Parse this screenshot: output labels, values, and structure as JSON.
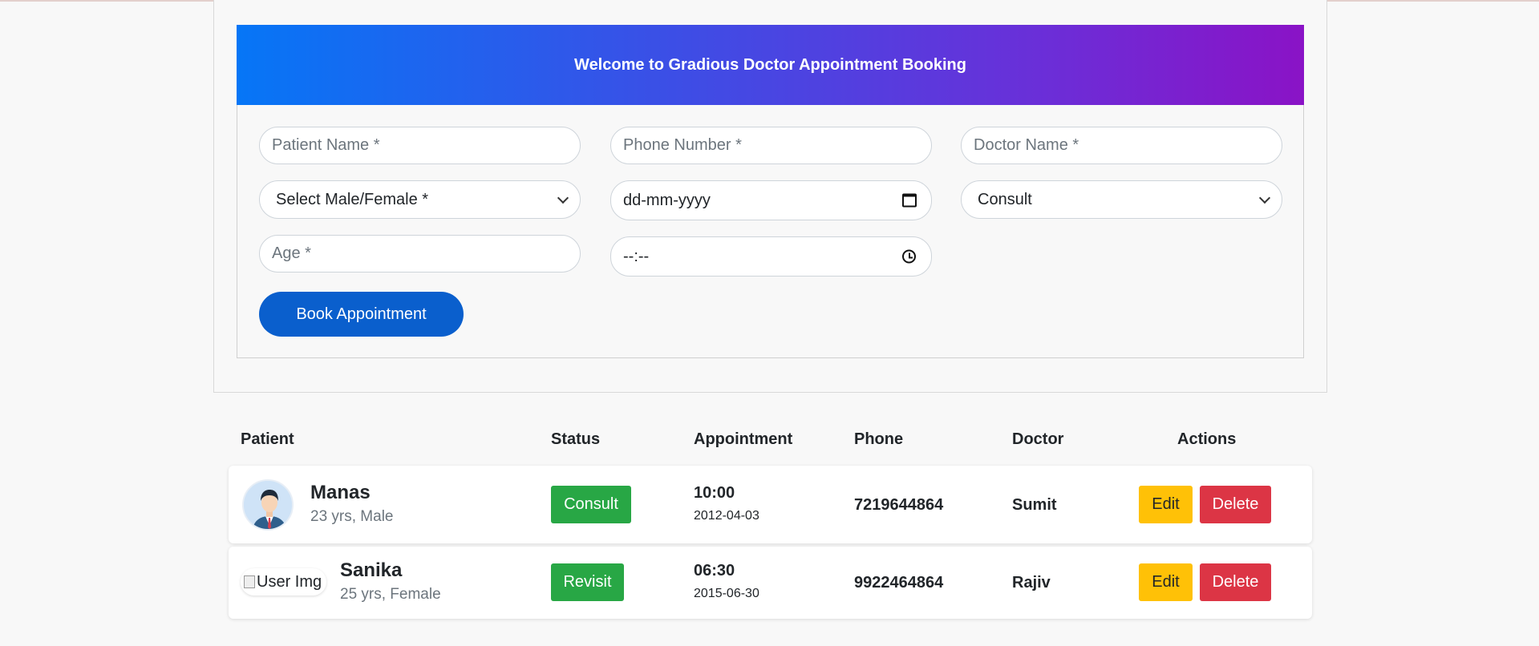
{
  "banner": {
    "title": "Welcome to Gradious Doctor Appointment Booking"
  },
  "form": {
    "patient_name_placeholder": "Patient Name *",
    "phone_placeholder": "Phone Number *",
    "doctor_placeholder": "Doctor Name *",
    "gender_selected": "Select Male/Female *",
    "date_placeholder": "dd-mm-yyyy",
    "visit_type_selected": "Consult",
    "age_placeholder": "Age *",
    "time_placeholder": "--:--",
    "submit_label": "Book Appointment"
  },
  "table": {
    "headers": [
      "Patient",
      "Status",
      "Appointment",
      "Phone",
      "Doctor",
      "Actions"
    ],
    "rows": [
      {
        "name": "Manas",
        "meta": "23 yrs, Male",
        "status": "Consult",
        "time": "10:00",
        "date": "2012-04-03",
        "phone": "7219644864",
        "doctor": "Sumit",
        "edit": "Edit",
        "delete": "Delete",
        "avatar_icon": "male-user-avatar"
      },
      {
        "name": "Sanika",
        "meta": "25 yrs, Female",
        "status": "Revisit",
        "time": "06:30",
        "date": "2015-06-30",
        "phone": "9922464864",
        "doctor": "Rajiv",
        "edit": "Edit",
        "delete": "Delete",
        "avatar_alt": "User Img"
      }
    ]
  },
  "colors": {
    "banner_start": "#0676f6",
    "banner_end": "#8a13c6",
    "primary_button": "#0a5fcd",
    "status_green": "#28a745",
    "edit_yellow": "#ffc107",
    "delete_red": "#dc3545"
  }
}
